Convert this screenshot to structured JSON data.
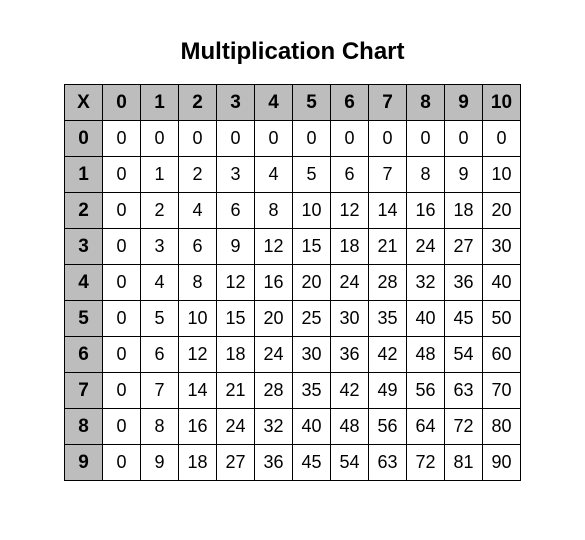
{
  "title": "Multiplication Chart",
  "corner": "X",
  "colHeaders": [
    "0",
    "1",
    "2",
    "3",
    "4",
    "5",
    "6",
    "7",
    "8",
    "9",
    "10"
  ],
  "rowHeaders": [
    "0",
    "1",
    "2",
    "3",
    "4",
    "5",
    "6",
    "7",
    "8",
    "9"
  ],
  "rows": [
    [
      "0",
      "0",
      "0",
      "0",
      "0",
      "0",
      "0",
      "0",
      "0",
      "0",
      "0"
    ],
    [
      "0",
      "1",
      "2",
      "3",
      "4",
      "5",
      "6",
      "7",
      "8",
      "9",
      "10"
    ],
    [
      "0",
      "2",
      "4",
      "6",
      "8",
      "10",
      "12",
      "14",
      "16",
      "18",
      "20"
    ],
    [
      "0",
      "3",
      "6",
      "9",
      "12",
      "15",
      "18",
      "21",
      "24",
      "27",
      "30"
    ],
    [
      "0",
      "4",
      "8",
      "12",
      "16",
      "20",
      "24",
      "28",
      "32",
      "36",
      "40"
    ],
    [
      "0",
      "5",
      "10",
      "15",
      "20",
      "25",
      "30",
      "35",
      "40",
      "45",
      "50"
    ],
    [
      "0",
      "6",
      "12",
      "18",
      "24",
      "30",
      "36",
      "42",
      "48",
      "54",
      "60"
    ],
    [
      "0",
      "7",
      "14",
      "21",
      "28",
      "35",
      "42",
      "49",
      "56",
      "63",
      "70"
    ],
    [
      "0",
      "8",
      "16",
      "24",
      "32",
      "40",
      "48",
      "56",
      "64",
      "72",
      "80"
    ],
    [
      "0",
      "9",
      "18",
      "27",
      "36",
      "45",
      "54",
      "63",
      "72",
      "81",
      "90"
    ]
  ],
  "chart_data": {
    "type": "table",
    "title": "Multiplication Chart",
    "xlabel": "",
    "ylabel": "",
    "row_labels": [
      0,
      1,
      2,
      3,
      4,
      5,
      6,
      7,
      8,
      9
    ],
    "col_labels": [
      0,
      1,
      2,
      3,
      4,
      5,
      6,
      7,
      8,
      9,
      10
    ],
    "values": [
      [
        0,
        0,
        0,
        0,
        0,
        0,
        0,
        0,
        0,
        0,
        0
      ],
      [
        0,
        1,
        2,
        3,
        4,
        5,
        6,
        7,
        8,
        9,
        10
      ],
      [
        0,
        2,
        4,
        6,
        8,
        10,
        12,
        14,
        16,
        18,
        20
      ],
      [
        0,
        3,
        6,
        9,
        12,
        15,
        18,
        21,
        24,
        27,
        30
      ],
      [
        0,
        4,
        8,
        12,
        16,
        20,
        24,
        28,
        32,
        36,
        40
      ],
      [
        0,
        5,
        10,
        15,
        20,
        25,
        30,
        35,
        40,
        45,
        50
      ],
      [
        0,
        6,
        12,
        18,
        24,
        30,
        36,
        42,
        48,
        54,
        60
      ],
      [
        0,
        7,
        14,
        21,
        28,
        35,
        42,
        49,
        56,
        63,
        70
      ],
      [
        0,
        8,
        16,
        24,
        32,
        40,
        48,
        56,
        64,
        72,
        80
      ],
      [
        0,
        9,
        18,
        27,
        36,
        45,
        54,
        63,
        72,
        81,
        90
      ]
    ]
  }
}
